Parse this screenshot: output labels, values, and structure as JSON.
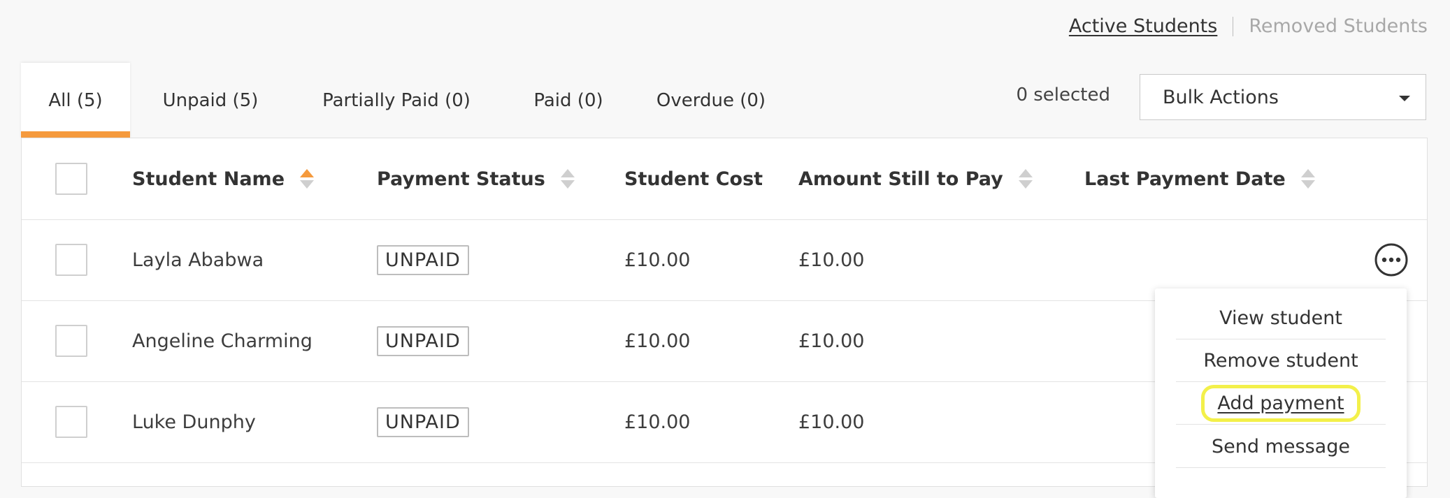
{
  "view_links": {
    "active": "Active Students",
    "inactive": "Removed Students"
  },
  "tabs": [
    {
      "label": "All (5)"
    },
    {
      "label": "Unpaid (5)"
    },
    {
      "label": "Partially Paid (0)"
    },
    {
      "label": "Paid (0)"
    },
    {
      "label": "Overdue (0)"
    }
  ],
  "selection": {
    "count_label": "0 selected"
  },
  "bulk_actions": {
    "label": "Bulk Actions"
  },
  "colors": {
    "accent": "#f59a3d",
    "highlight": "#f3f04a"
  },
  "table": {
    "headers": {
      "name": "Student Name",
      "status": "Payment Status",
      "cost": "Student Cost",
      "still": "Amount Still to Pay",
      "date": "Last Payment Date"
    },
    "rows": [
      {
        "name": "Layla Ababwa",
        "status": "UNPAID",
        "cost": "£10.00",
        "still": "£10.00"
      },
      {
        "name": "Angeline Charming",
        "status": "UNPAID",
        "cost": "£10.00",
        "still": "£10.00"
      },
      {
        "name": "Luke Dunphy",
        "status": "UNPAID",
        "cost": "£10.00",
        "still": "£10.00"
      }
    ]
  },
  "row_menu": {
    "items": [
      "View student",
      "Remove student",
      "Add payment",
      "Send message"
    ]
  }
}
